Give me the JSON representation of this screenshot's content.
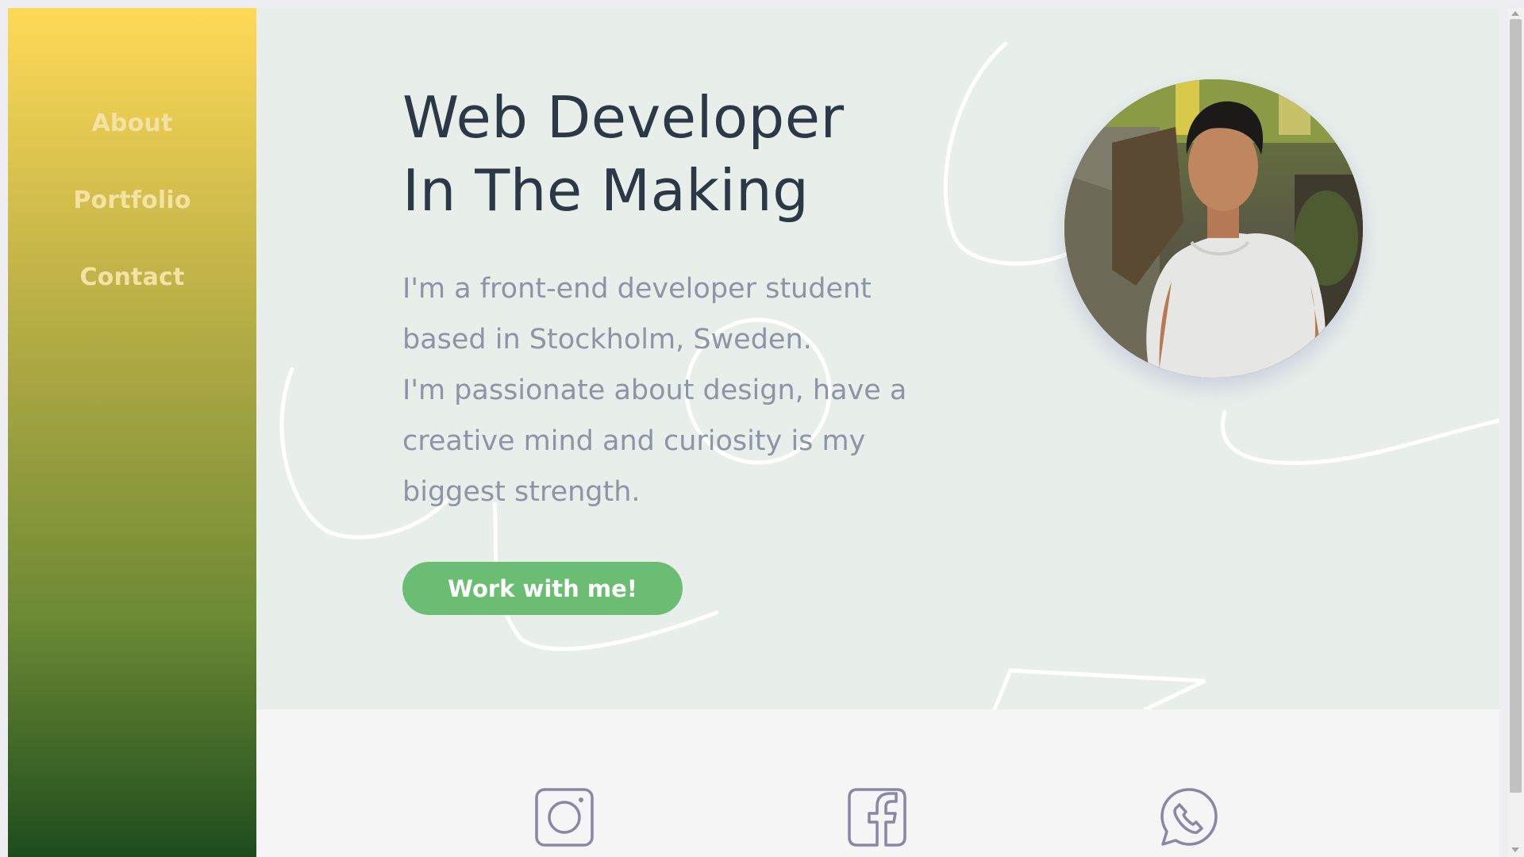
{
  "nav": {
    "items": [
      {
        "label": "About"
      },
      {
        "label": "Portfolio"
      },
      {
        "label": "Contact"
      }
    ]
  },
  "hero": {
    "title_lines": [
      "Web Developer",
      "In The Making"
    ],
    "text_lines": [
      "I'm a front-end developer student",
      "based in Stockholm, Sweden.",
      "I'm passionate about design, have a",
      "creative mind and curiosity is my",
      "biggest strength."
    ],
    "cta_label": "Work with me!"
  },
  "social": {
    "icons": [
      "instagram-icon",
      "facebook-icon",
      "whatsapp-icon"
    ]
  },
  "colors": {
    "sidebar_gradient": [
      "#ffd957",
      "#b4ac45",
      "#6c8934",
      "#1d4c1c"
    ],
    "nav_text": "#f4e1a4",
    "hero_bg": "#e8efeb",
    "title": "#2c3846",
    "body_text": "#8c94a5",
    "cta": "#6cbd74",
    "social_icon": "#8a86a6"
  }
}
